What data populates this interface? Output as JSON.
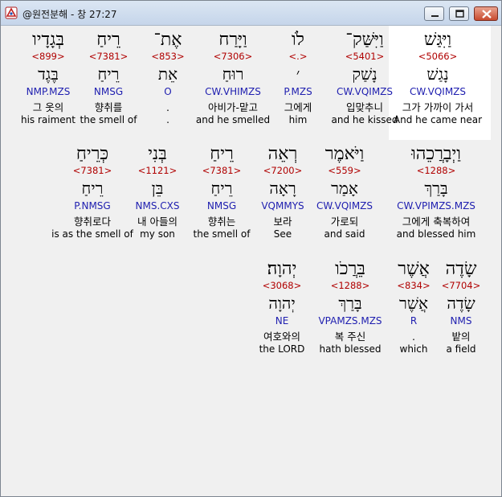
{
  "window": {
    "title": "@원전분해 - 창 27:27"
  },
  "colors": {
    "strong": "#b00000",
    "morph": "#2020b0",
    "highlight_bg": "#ffffff",
    "window_bg": "#f0f0f0"
  },
  "rows": [
    {
      "words": [
        {
          "heb": "וַיִּגַּשׁ",
          "strong": "<5066>",
          "root": "נָגַשׁ",
          "morph": "CW.VQIMZS",
          "kor": "그가 가까이 가서",
          "eng": "And he came near",
          "selected": true
        },
        {
          "heb": "וַיִּשַּׁק־",
          "strong": "<5401>",
          "root": "נָשַׁק",
          "morph": "CW.VQIMZS",
          "kor": "입맞추니",
          "eng": "and he kissed"
        },
        {
          "heb": "לֹו",
          "strong": "<.>",
          "root": "׳",
          "morph": "P.MZS",
          "kor": "그에게",
          "eng": "him"
        },
        {
          "heb": "וַיָּרַח",
          "strong": "<7306>",
          "root": "רוּחַ",
          "morph": "CW.VHIMZS",
          "kor": "아비가-맡고",
          "eng": "and he smelled"
        },
        {
          "heb": "אֶת־",
          "strong": "<853>",
          "root": "אֵת",
          "morph": "O",
          "kor": ".",
          "eng": "."
        },
        {
          "heb": "רֵיחַ",
          "strong": "<7381>",
          "root": "רֵיחַ",
          "morph": "NMSG",
          "kor": "향취를",
          "eng": "the smell of"
        },
        {
          "heb": "בְּגָדָיו",
          "strong": "<899>",
          "root": "בֶּגֶד",
          "morph": "NMP.MZS",
          "kor": "그 옷의",
          "eng": "his raiment"
        }
      ]
    },
    {
      "words": [
        {
          "heb": "וַיְבָרֲכֵהוּ",
          "strong": "<1288>",
          "root": "בָּרַךְ",
          "morph": "CW.VPIMZS.MZS",
          "kor": "그에게 축복하여",
          "eng": "and blessed him"
        },
        {
          "heb": "וַיֹּאמֶר",
          "strong": "<559>",
          "root": "אָמַר",
          "morph": "CW.VQIMZS",
          "kor": "가로되",
          "eng": "and said"
        },
        {
          "heb": "רְאֵה",
          "strong": "<7200>",
          "root": "רָאָה",
          "morph": "VQMMYS",
          "kor": "보라",
          "eng": "See"
        },
        {
          "heb": "רֵיחַ",
          "strong": "<7381>",
          "root": "רֵיחַ",
          "morph": "NMSG",
          "kor": "향취는",
          "eng": "the smell of"
        },
        {
          "heb": "בְּנִי",
          "strong": "<1121>",
          "root": "בֵּן",
          "morph": "NMS.CXS",
          "kor": "내 아들의",
          "eng": "my son"
        },
        {
          "heb": "כְּרֵיחַ",
          "strong": "<7381>",
          "root": "רֵיחַ",
          "morph": "P.NMSG",
          "kor": "향취로다",
          "eng": "is as the smell of"
        }
      ]
    },
    {
      "words": [
        {
          "heb": "שָׂדֶה",
          "strong": "<7704>",
          "root": "שָׂדֶה",
          "morph": "NMS",
          "kor": "밭의",
          "eng": "a field"
        },
        {
          "heb": "אֲשֶׁר",
          "strong": "<834>",
          "root": "אֲשֶׁר",
          "morph": "R",
          "kor": ".",
          "eng": "which"
        },
        {
          "heb": "בֵּרֲכֹו",
          "strong": "<1288>",
          "root": "בָּרַךְ",
          "morph": "VPAMZS.MZS",
          "kor": "복 주신",
          "eng": "hath blessed"
        },
        {
          "heb": "יְהוָה׃",
          "strong": "<3068>",
          "root": "יְהוָה",
          "morph": "NE",
          "kor": "여호와의",
          "eng": "the LORD"
        }
      ]
    }
  ]
}
